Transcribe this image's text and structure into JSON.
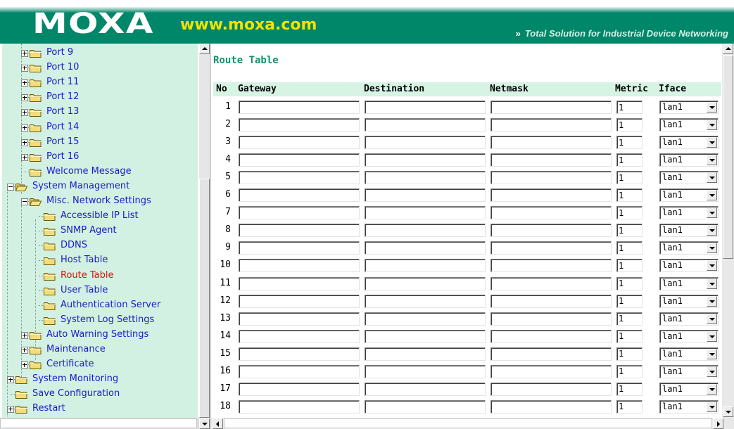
{
  "banner": {
    "logo": "MOXA",
    "url": "www.moxa.com",
    "tagline": "Total Solution for Industrial Device Networking",
    "tagline_icon": "double-chevron-icon"
  },
  "colors": {
    "banner_bg": "#008668",
    "url_text": "#f4e200",
    "tree_bg": "#d3f1e2",
    "link_text": "#1a1acc",
    "active_link": "#dd1111",
    "title_text": "#198f6a",
    "header_bg": "#d6f3e4"
  },
  "tree": {
    "items": [
      {
        "label": "Port 9",
        "icon": "folder-closed-icon",
        "expander": "plus"
      },
      {
        "label": "Port 10",
        "icon": "folder-closed-icon",
        "expander": "plus"
      },
      {
        "label": "Port 11",
        "icon": "folder-closed-icon",
        "expander": "plus"
      },
      {
        "label": "Port 12",
        "icon": "folder-closed-icon",
        "expander": "plus"
      },
      {
        "label": "Port 13",
        "icon": "folder-closed-icon",
        "expander": "plus"
      },
      {
        "label": "Port 14",
        "icon": "folder-closed-icon",
        "expander": "plus"
      },
      {
        "label": "Port 15",
        "icon": "folder-closed-icon",
        "expander": "plus"
      },
      {
        "label": "Port 16",
        "icon": "folder-closed-icon",
        "expander": "plus"
      },
      {
        "label": "Welcome Message",
        "icon": "folder-closed-icon",
        "expander": "none"
      },
      {
        "label": "System Management",
        "icon": "folder-open-icon",
        "expander": "minus"
      },
      {
        "label": "Misc. Network Settings",
        "icon": "folder-open-icon",
        "expander": "minus"
      },
      {
        "label": "Accessible IP List",
        "icon": "folder-closed-icon",
        "expander": "none"
      },
      {
        "label": "SNMP Agent",
        "icon": "folder-closed-icon",
        "expander": "none"
      },
      {
        "label": "DDNS",
        "icon": "folder-closed-icon",
        "expander": "none"
      },
      {
        "label": "Host Table",
        "icon": "folder-closed-icon",
        "expander": "none"
      },
      {
        "label": "Route Table",
        "icon": "folder-closed-icon",
        "expander": "none",
        "active": true
      },
      {
        "label": "User Table",
        "icon": "folder-closed-icon",
        "expander": "none"
      },
      {
        "label": "Authentication Server",
        "icon": "folder-closed-icon",
        "expander": "none"
      },
      {
        "label": "System Log Settings",
        "icon": "folder-closed-icon",
        "expander": "none"
      },
      {
        "label": "Auto Warning Settings",
        "icon": "folder-closed-icon",
        "expander": "plus"
      },
      {
        "label": "Maintenance",
        "icon": "folder-closed-icon",
        "expander": "plus"
      },
      {
        "label": "Certificate",
        "icon": "folder-closed-icon",
        "expander": "plus"
      },
      {
        "label": "System Monitoring",
        "icon": "folder-closed-icon",
        "expander": "plus"
      },
      {
        "label": "Save Configuration",
        "icon": "folder-closed-icon",
        "expander": "none"
      },
      {
        "label": "Restart",
        "icon": "folder-closed-icon",
        "expander": "plus"
      }
    ]
  },
  "main": {
    "title": "Route Table",
    "columns": {
      "no": "No",
      "gateway": "Gateway",
      "destination": "Destination",
      "netmask": "Netmask",
      "metric": "Metric",
      "iface": "Iface"
    },
    "rows": [
      {
        "no": "1",
        "gateway": "",
        "destination": "",
        "netmask": "",
        "metric": "1",
        "iface": "lan1"
      },
      {
        "no": "2",
        "gateway": "",
        "destination": "",
        "netmask": "",
        "metric": "1",
        "iface": "lan1"
      },
      {
        "no": "3",
        "gateway": "",
        "destination": "",
        "netmask": "",
        "metric": "1",
        "iface": "lan1"
      },
      {
        "no": "4",
        "gateway": "",
        "destination": "",
        "netmask": "",
        "metric": "1",
        "iface": "lan1"
      },
      {
        "no": "5",
        "gateway": "",
        "destination": "",
        "netmask": "",
        "metric": "1",
        "iface": "lan1"
      },
      {
        "no": "6",
        "gateway": "",
        "destination": "",
        "netmask": "",
        "metric": "1",
        "iface": "lan1"
      },
      {
        "no": "7",
        "gateway": "",
        "destination": "",
        "netmask": "",
        "metric": "1",
        "iface": "lan1"
      },
      {
        "no": "8",
        "gateway": "",
        "destination": "",
        "netmask": "",
        "metric": "1",
        "iface": "lan1"
      },
      {
        "no": "9",
        "gateway": "",
        "destination": "",
        "netmask": "",
        "metric": "1",
        "iface": "lan1"
      },
      {
        "no": "10",
        "gateway": "",
        "destination": "",
        "netmask": "",
        "metric": "1",
        "iface": "lan1"
      },
      {
        "no": "11",
        "gateway": "",
        "destination": "",
        "netmask": "",
        "metric": "1",
        "iface": "lan1"
      },
      {
        "no": "12",
        "gateway": "",
        "destination": "",
        "netmask": "",
        "metric": "1",
        "iface": "lan1"
      },
      {
        "no": "13",
        "gateway": "",
        "destination": "",
        "netmask": "",
        "metric": "1",
        "iface": "lan1"
      },
      {
        "no": "14",
        "gateway": "",
        "destination": "",
        "netmask": "",
        "metric": "1",
        "iface": "lan1"
      },
      {
        "no": "15",
        "gateway": "",
        "destination": "",
        "netmask": "",
        "metric": "1",
        "iface": "lan1"
      },
      {
        "no": "16",
        "gateway": "",
        "destination": "",
        "netmask": "",
        "metric": "1",
        "iface": "lan1"
      },
      {
        "no": "17",
        "gateway": "",
        "destination": "",
        "netmask": "",
        "metric": "1",
        "iface": "lan1"
      },
      {
        "no": "18",
        "gateway": "",
        "destination": "",
        "netmask": "",
        "metric": "1",
        "iface": "lan1"
      }
    ]
  }
}
